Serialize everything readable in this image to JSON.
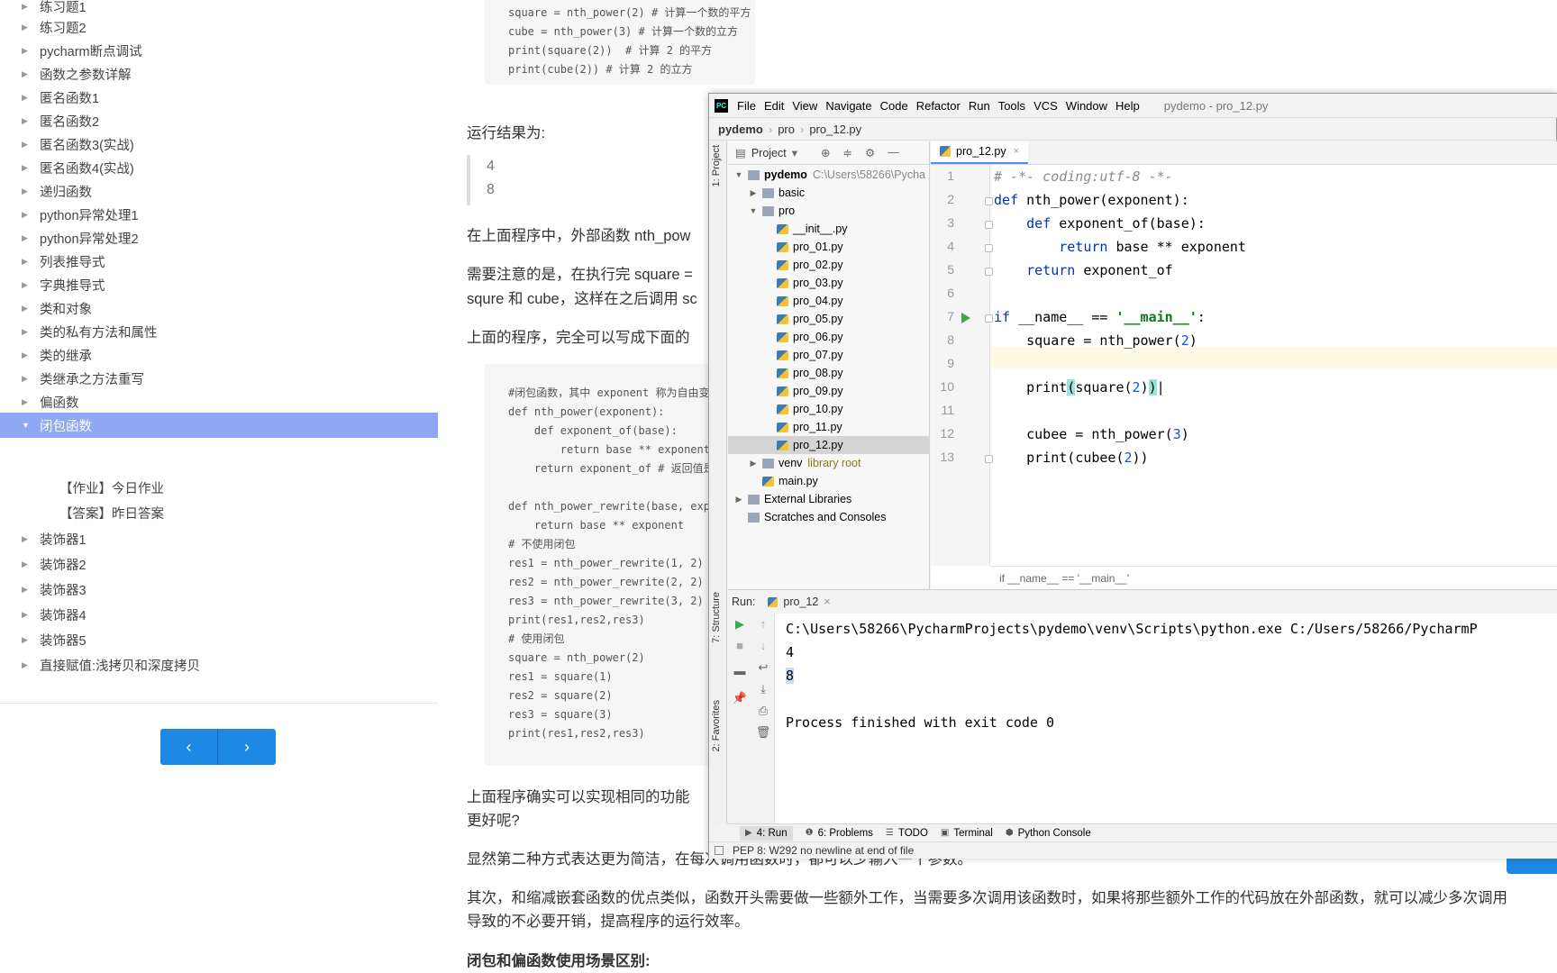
{
  "sidebar": {
    "items": [
      {
        "label": "练习题1"
      },
      {
        "label": "练习题2"
      },
      {
        "label": "pycharm断点调试"
      },
      {
        "label": "函数之参数详解"
      },
      {
        "label": "匿名函数1"
      },
      {
        "label": "匿名函数2"
      },
      {
        "label": "匿名函数3(实战)"
      },
      {
        "label": "匿名函数4(实战)"
      },
      {
        "label": "递归函数"
      },
      {
        "label": "python异常处理1"
      },
      {
        "label": "python异常处理2"
      },
      {
        "label": "列表推导式"
      },
      {
        "label": "字典推导式"
      },
      {
        "label": "类和对象"
      },
      {
        "label": "类的私有方法和属性"
      },
      {
        "label": "类的继承"
      },
      {
        "label": "类继承之方法重写"
      },
      {
        "label": "偏函数"
      },
      {
        "label": "闭包函数"
      }
    ],
    "sub_items": [
      {
        "label": "【作业】今日作业"
      },
      {
        "label": "【答案】昨日答案"
      }
    ],
    "more_items": [
      {
        "label": "装饰器1"
      },
      {
        "label": "装饰器2"
      },
      {
        "label": "装饰器3"
      },
      {
        "label": "装饰器4"
      },
      {
        "label": "装饰器5"
      },
      {
        "label": "直接赋值:浅拷贝和深度拷贝"
      }
    ],
    "prev": "‹",
    "next": "›"
  },
  "article": {
    "code_top": [
      "square = nth_power(2) # 计算一个数的平方",
      "cube = nth_power(3) # 计算一个数的立方",
      "print(square(2))  # 计算 2 的平方",
      "print(cube(2)) # 计算 2 的立方"
    ],
    "run_result_label": "运行结果为:",
    "quote_lines": [
      "4",
      "8"
    ],
    "p1": "在上面程序中，外部函数 nth_pow",
    "p2a": "需要注意的是，在执行完 square =",
    "p2b": "squre 和 cube，这样在之后调用 sc",
    "p3": "上面的程序，完全可以写成下面的",
    "code_mid": [
      "#闭包函数，其中 exponent 称为自由变",
      "def nth_power(exponent):",
      "    def exponent_of(base):",
      "        return base ** exponent",
      "    return exponent_of # 返回值是 e",
      "",
      "def nth_power_rewrite(base, exponen",
      "    return base ** exponent",
      "# 不使用闭包",
      "res1 = nth_power_rewrite(1, 2)",
      "res2 = nth_power_rewrite(2, 2)",
      "res3 = nth_power_rewrite(3, 2)",
      "print(res1,res2,res3)",
      "# 使用闭包",
      "square = nth_power(2)",
      "res1 = square(1)",
      "res2 = square(2)",
      "res3 = square(3)",
      "print(res1,res2,res3)"
    ],
    "p4a": "上面程序确实可以实现相同的功能",
    "p4b": "更好呢?",
    "p5": "显然第二种方式表达更为简洁，在每次调用函数时，都可以少输入一个参数。",
    "p6a": "其次，和缩减嵌套函数的优点类似，函数开头需要做一些额外工作，当需要多次调用该函数时，如果将那些额外工作的代码放在外部函数，就可以减少多次调用",
    "p6b": "导致的不必要开销，提高程序的运行效率。",
    "h_bottom": "闭包和偏函数使用场景区别:"
  },
  "ide": {
    "logo": "PC",
    "menus": [
      "File",
      "Edit",
      "View",
      "Navigate",
      "Code",
      "Refactor",
      "Run",
      "Tools",
      "VCS",
      "Window",
      "Help"
    ],
    "window_title": "pydemo - pro_12.py",
    "nav": [
      "pydemo",
      "pro",
      "pro_12.py"
    ],
    "left_tabs": {
      "project": "1: Project",
      "structure": "7: Structure",
      "favorites": "2: Favorites"
    },
    "project_label": "Project",
    "tree": {
      "root": "pydemo",
      "root_path": "C:\\Users\\58266\\Pycha",
      "basic": "basic",
      "pro": "pro",
      "files": [
        "__init__.py",
        "pro_01.py",
        "pro_02.py",
        "pro_03.py",
        "pro_04.py",
        "pro_05.py",
        "pro_06.py",
        "pro_07.py",
        "pro_08.py",
        "pro_09.py",
        "pro_10.py",
        "pro_11.py",
        "pro_12.py"
      ],
      "venv": "venv",
      "venv_note": "library root",
      "main": "main.py",
      "ext": "External Libraries",
      "scratch": "Scratches and Consoles"
    },
    "editor_tab": "pro_12.py",
    "line_numbers": [
      "1",
      "2",
      "3",
      "4",
      "5",
      "6",
      "7",
      "8",
      "9",
      "10",
      "11",
      "12",
      "13"
    ],
    "breadcrumb": "if __name__ == '__main__'",
    "run_label": "Run:",
    "run_tab": "pro_12",
    "output": [
      "C:\\Users\\58266\\PycharmProjects\\pydemo\\venv\\Scripts\\python.exe C:/Users/58266/PycharmP",
      "4",
      "8",
      "",
      "Process finished with exit code 0"
    ],
    "bottom_tabs": [
      "4: Run",
      "6: Problems",
      "TODO",
      "Terminal",
      "Python Console"
    ],
    "status_msg": "PEP 8: W292 no newline at end of file"
  },
  "colors": {
    "accent": "#8fa8f5",
    "button": "#1e88e5"
  }
}
